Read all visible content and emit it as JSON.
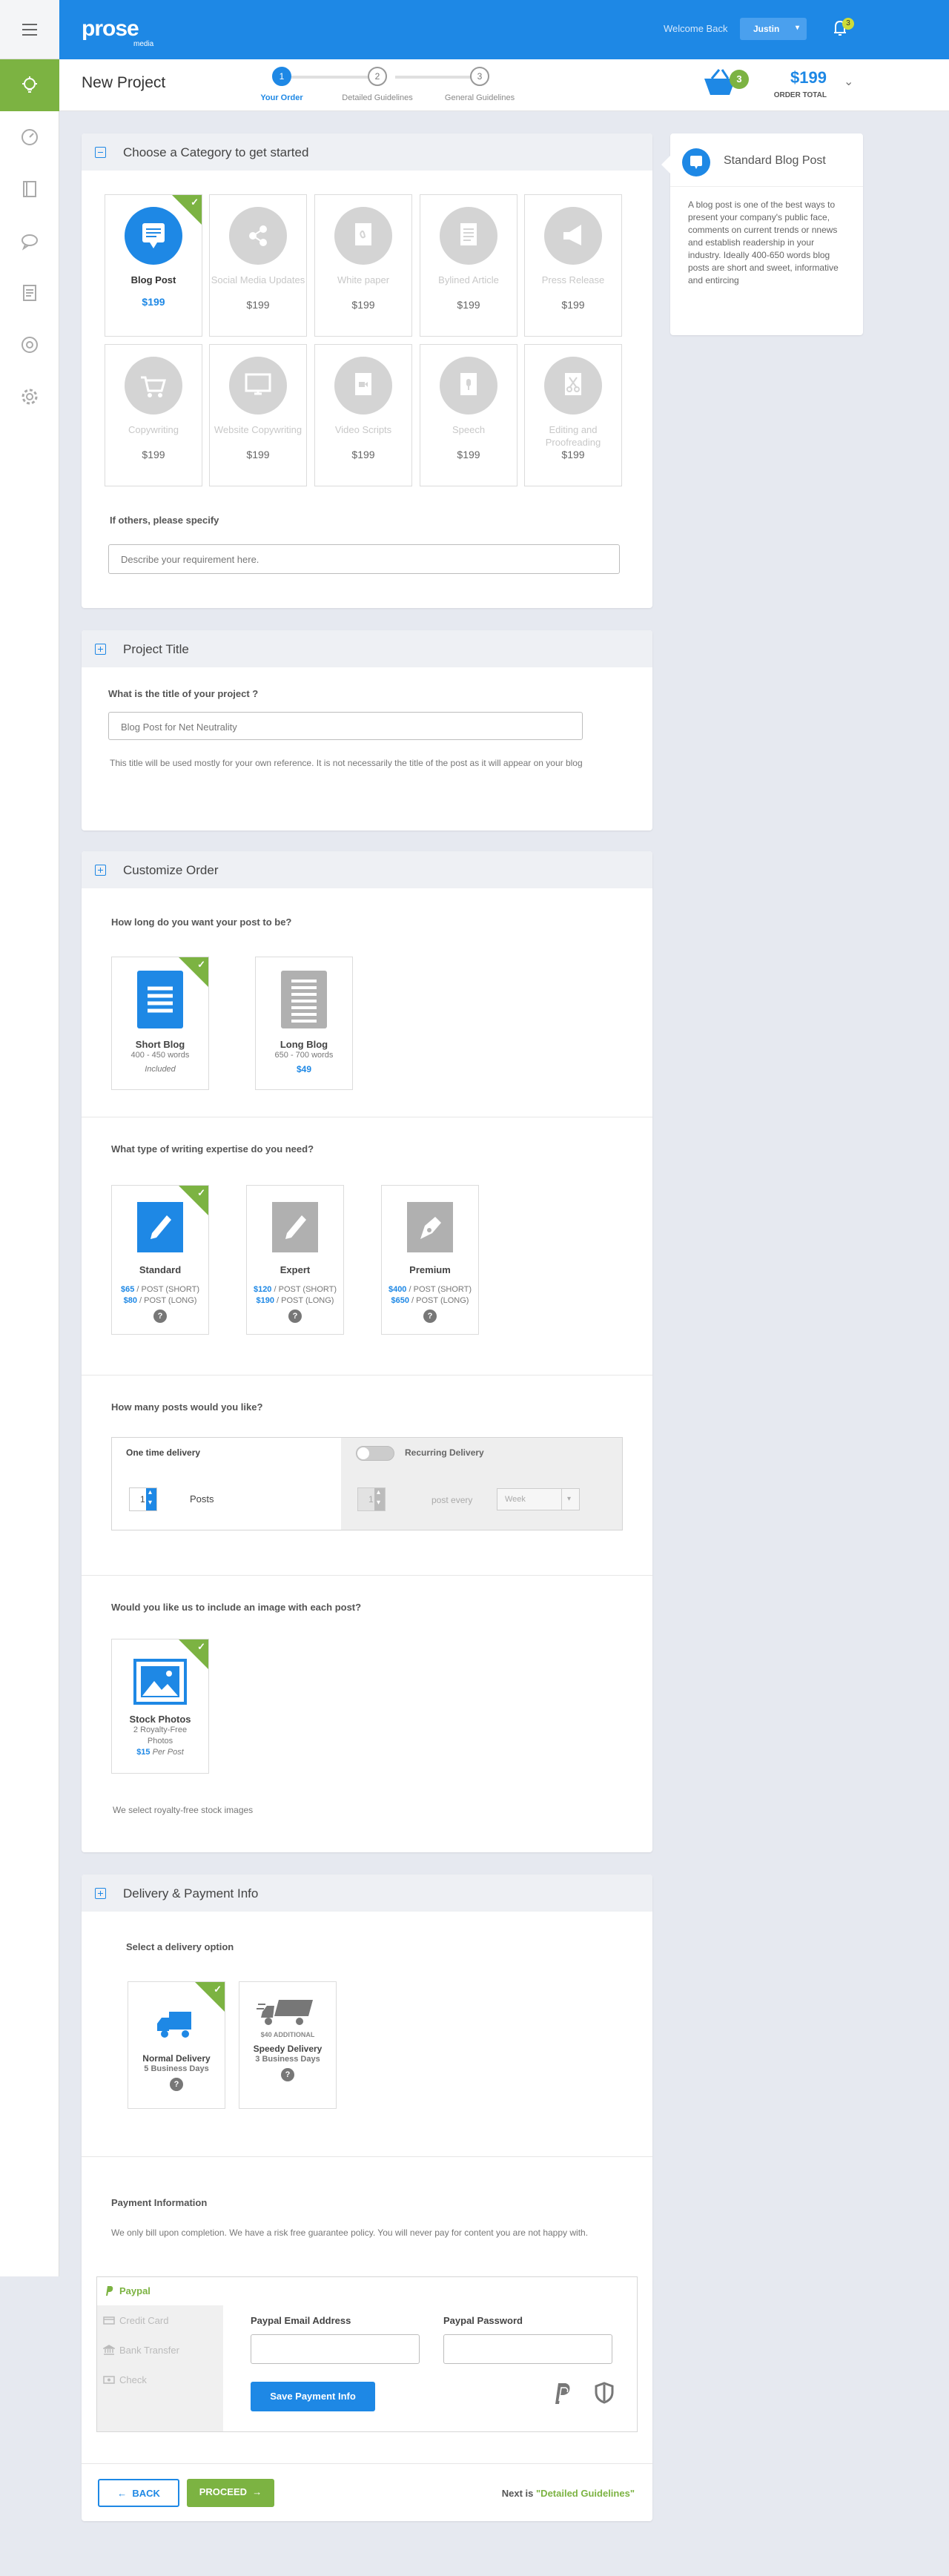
{
  "header": {
    "logo_text": "prose",
    "logo_sub": "media",
    "welcome": "Welcome Back",
    "user": "Justin",
    "notif_count": "3",
    "colors": {
      "primary": "#1e88e5",
      "green": "#7cb342"
    }
  },
  "sidebar": {
    "items": [
      {
        "icon": "bulb-icon"
      },
      {
        "icon": "gauge-icon"
      },
      {
        "icon": "book-icon"
      },
      {
        "icon": "chat-icon"
      },
      {
        "icon": "document-icon"
      },
      {
        "icon": "support-icon"
      },
      {
        "icon": "gear-icon"
      }
    ]
  },
  "subheader": {
    "title": "New Project",
    "steps": [
      {
        "num": "1",
        "label": "Your Order"
      },
      {
        "num": "2",
        "label": "Detailed Guidelines"
      },
      {
        "num": "3",
        "label": "General Guidelines"
      }
    ],
    "cart_count": "3",
    "total": "$199",
    "total_label": "ORDER TOTAL"
  },
  "category": {
    "title": "Choose a Category to get started",
    "tiles": [
      {
        "name": "Blog Post",
        "price": "$199"
      },
      {
        "name": "Social Media Updates",
        "price": "$199"
      },
      {
        "name": "White paper",
        "price": "$199"
      },
      {
        "name": "Bylined Article",
        "price": "$199"
      },
      {
        "name": "Press Release",
        "price": "$199"
      },
      {
        "name": "Copywriting",
        "price": "$199"
      },
      {
        "name": "Website Copywriting",
        "price": "$199"
      },
      {
        "name": "Video Scripts",
        "price": "$199"
      },
      {
        "name": "Speech",
        "price": "$199"
      },
      {
        "name": "Editing and Proofreading",
        "price": "$199"
      }
    ],
    "others_label": "If others, please specify",
    "others_placeholder": "Describe your requirement here."
  },
  "info": {
    "title": "Standard Blog Post",
    "text": "A blog post is one of the best ways to present your company's public face, comments on current trends or nnews and establish readership in your industry. Ideally 400-650 words blog posts are short and sweet, informative and entircing"
  },
  "project": {
    "title": "Project Title",
    "question": "What is the title of your project ?",
    "value": "Blog Post for Net Neutrality",
    "note": "This title will be used mostly for your own reference. It is not necessarily the title of the post as it will appear on your blog"
  },
  "customize": {
    "title": "Customize Order",
    "length_q": "How long do you want your post to be?",
    "lengths": [
      {
        "name": "Short Blog",
        "words": "400 - 450 words",
        "price": "Included"
      },
      {
        "name": "Long Blog",
        "words": "650 - 700 words",
        "price": "$49"
      }
    ],
    "expertise_q": "What type of writing expertise do you need?",
    "expertise": [
      {
        "name": "Standard",
        "short_price": "$65",
        "short_label": " / POST (SHORT)",
        "long_price": "$80",
        "long_label": " / POST (LONG)"
      },
      {
        "name": "Expert",
        "short_price": "$120",
        "short_label": " / POST (SHORT)",
        "long_price": "$190",
        "long_label": " / POST (LONG)"
      },
      {
        "name": "Premium",
        "short_price": "$400",
        "short_label": " / POST (SHORT)",
        "long_price": "$650",
        "long_label": " / POST (LONG)"
      }
    ],
    "help": "?",
    "posts_q": "How many posts would you like?",
    "one_time": "One time delivery",
    "qty": "1",
    "posts_label": "Posts",
    "recurring": "Recurring Delivery",
    "rec_qty": "1",
    "post_every": "post every",
    "period": "Week",
    "image_q": "Would you like us to include an image with each post?",
    "stock_name": "Stock Photos",
    "stock_sub": "2 Royalty-Free Photos",
    "stock_price": "$15",
    "stock_per": " Per Post",
    "stock_note": "We select royalty-free stock images"
  },
  "delivery": {
    "title": "Delivery & Payment Info",
    "select_label": "Select a delivery option",
    "options": [
      {
        "name": "Normal Delivery",
        "days": "5 Business Days",
        "extra": ""
      },
      {
        "name": "Speedy Delivery",
        "days": "3 Business Days",
        "extra": "$40 ADDITIONAL"
      }
    ],
    "payment_title": "Payment Information",
    "payment_note": "We only bill upon completion. We have a risk free guarantee policy. You will never pay for content you are not happy with.",
    "methods": [
      "Paypal",
      "Credit Card",
      "Bank Transfer",
      "Check"
    ],
    "email_label": "Paypal Email Address",
    "password_label": "Paypal Password",
    "save_button": "Save Payment Info"
  },
  "footer": {
    "back": "BACK",
    "proceed": "PROCEED",
    "next_prefix": "Next is",
    "next_link": "\"Detailed Guidelines\""
  }
}
